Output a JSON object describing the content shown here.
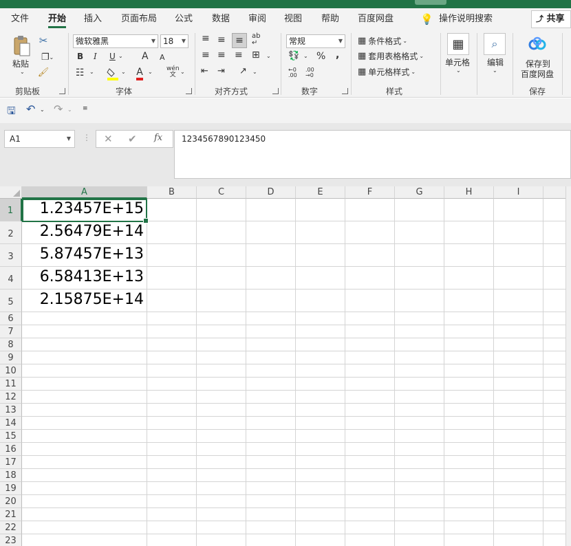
{
  "ribbon_tabs": [
    "文件",
    "开始",
    "插入",
    "页面布局",
    "公式",
    "数据",
    "审阅",
    "视图",
    "帮助",
    "百度网盘",
    "操作说明搜索"
  ],
  "share_label": "共享",
  "clipboard": {
    "paste_label": "粘贴",
    "group_label": "剪贴板"
  },
  "font": {
    "name": "微软雅黑",
    "size": "18",
    "bold": "B",
    "italic": "I",
    "underline": "U",
    "grow": "A",
    "shrink": "A",
    "font_color_glyph": "A",
    "phonetic_glyph": "wén\n文",
    "group_label": "字体"
  },
  "alignment": {
    "group_label": "对齐方式"
  },
  "number": {
    "format": "常规",
    "percent": "%",
    "comma": ",",
    "group_label": "数字"
  },
  "styles": {
    "conditional": "条件格式",
    "table_format": "套用表格格式",
    "cell_styles": "单元格样式",
    "group_label": "样式"
  },
  "cells": {
    "label": "单元格"
  },
  "editing": {
    "label": "编辑"
  },
  "save": {
    "label_line1": "保存到",
    "label_line2": "百度网盘",
    "group_label": "保存"
  },
  "name_box": "A1",
  "formula_value": "1234567890123450",
  "columns": [
    "A",
    "B",
    "C",
    "D",
    "E",
    "F",
    "G",
    "H",
    "I"
  ],
  "rows": [
    "1",
    "2",
    "3",
    "4",
    "5",
    "6",
    "7",
    "8",
    "9",
    "10",
    "11",
    "12",
    "13",
    "14",
    "15",
    "16",
    "17",
    "18",
    "19",
    "20",
    "21",
    "22",
    "23"
  ],
  "cell_values": [
    "1.23457E+15",
    "2.56479E+14",
    "5.87457E+13",
    "6.58413E+13",
    "2.15875E+14"
  ],
  "colors": {
    "accent": "#217346"
  }
}
